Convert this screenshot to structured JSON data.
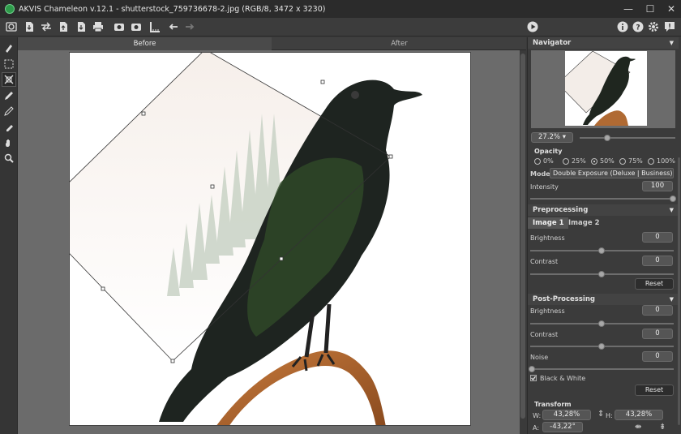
{
  "window": {
    "title": "AKVIS Chameleon v.12.1 - shutterstock_759736678-2.jpg (RGB/8, 3472 x 3230)"
  },
  "toolbar": {
    "icons": [
      "home-icon",
      "open-icon",
      "swap-icon",
      "import-icon",
      "export-icon",
      "print-icon",
      "camera-icon",
      "share-icon",
      "ruler-icon",
      "undo-icon",
      "redo-icon",
      "run-icon",
      "info-icon",
      "help-icon",
      "settings-icon",
      "notification-icon"
    ]
  },
  "tools": [
    "selection-brush-icon",
    "rectangle-select-icon",
    "transform-icon",
    "refine-brush-icon",
    "eraser-icon",
    "clone-icon",
    "hand-icon",
    "zoom-icon"
  ],
  "tabs": {
    "before": "Before",
    "after": "After"
  },
  "navigator": {
    "title": "Navigator",
    "zoom": "27.2%"
  },
  "opacity": {
    "title": "Opacity",
    "options": [
      "0%",
      "25%",
      "50%",
      "75%",
      "100%"
    ],
    "selected": "50%"
  },
  "mode": {
    "label": "Mode",
    "value": "Double Exposure (Deluxe | Business)"
  },
  "intensity": {
    "label": "Intensity",
    "value": "100",
    "level": 1.0
  },
  "preprocessing": {
    "title": "Preprocessing",
    "tab1": "Image 1",
    "tab2": "Image 2",
    "brightness_label": "Brightness",
    "brightness_value": "0",
    "contrast_label": "Contrast",
    "contrast_value": "0",
    "reset_label": "Reset"
  },
  "postprocessing": {
    "title": "Post-Processing",
    "brightness_label": "Brightness",
    "brightness_value": "0",
    "contrast_label": "Contrast",
    "contrast_value": "0",
    "noise_label": "Noise",
    "noise_value": "0",
    "bw_label": "Black & White",
    "bw_checked": true,
    "reset_label": "Reset"
  },
  "transform": {
    "title": "Transform",
    "w_label": "W:",
    "w_value": "43,28%",
    "h_label": "H:",
    "h_value": "43,28%",
    "a_label": "A:",
    "a_value": "-43,22°"
  }
}
